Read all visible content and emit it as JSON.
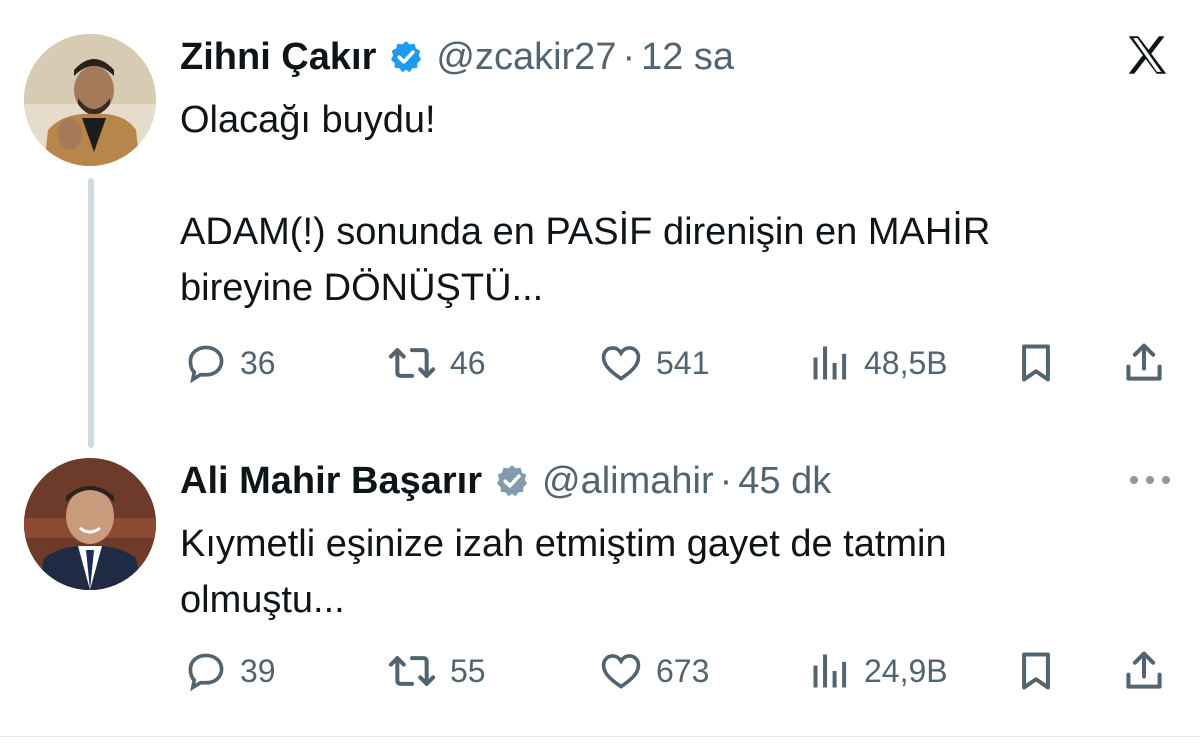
{
  "tweets": [
    {
      "name": "Zihni Çakır",
      "handle": "@zcakir27",
      "separator": "·",
      "time": "12 sa",
      "text_lines": [
        "Olacağı buydu!",
        "",
        "ADAM(!) sonunda en PASİF direnişin en MAHİR",
        "bireyine DÖNÜŞTÜ..."
      ],
      "replies": "36",
      "retweets": "46",
      "likes": "541",
      "views": "48,5B"
    },
    {
      "name": "Ali Mahir Başarır",
      "handle": "@alimahir",
      "separator": "·",
      "time": "45 dk",
      "text_lines": [
        "Kıymetli eşinize izah etmiştim gayet de tatmin",
        "olmuştu..."
      ],
      "replies": "39",
      "retweets": "55",
      "likes": "673",
      "views": "24,9B"
    }
  ],
  "icons": {
    "verified": "verified-badge-icon",
    "reply": "reply-icon",
    "retweet": "retweet-icon",
    "like": "heart-icon",
    "views": "views-icon",
    "bookmark": "bookmark-icon",
    "share": "share-icon",
    "x_logo": "x-logo-icon",
    "more": "more-icon"
  },
  "colors": {
    "verified_blue": "#1d9bf0",
    "verified_gray": "#829aab",
    "text": "#0f1419",
    "secondary": "#536471"
  }
}
